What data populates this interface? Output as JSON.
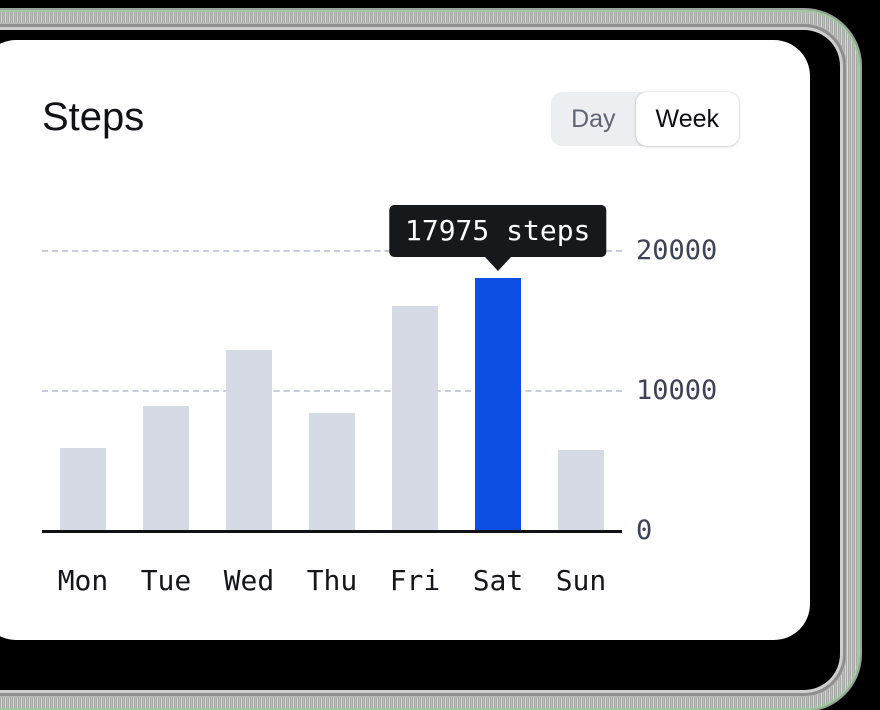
{
  "card": {
    "title": "Steps"
  },
  "range_toggle": {
    "options": [
      {
        "label": "Day",
        "active": false
      },
      {
        "label": "Week",
        "active": true
      }
    ]
  },
  "tooltip": {
    "text": "17975 steps",
    "anchor_category": "Sat",
    "background": "#17181c",
    "text_color": "#ffffff"
  },
  "colors": {
    "bar": "#d6dae4",
    "bar_highlight": "#0b4fe5",
    "gridline": "#c9cddb",
    "axis": "#111216",
    "toggle_track": "#eceef2",
    "toggle_active_bg": "#ffffff",
    "toggle_inactive_text": "#5f6474",
    "card_background": "#ffffff"
  },
  "chart_data": {
    "type": "bar",
    "title": "Steps",
    "xlabel": "",
    "ylabel": "",
    "categories": [
      "Mon",
      "Tue",
      "Wed",
      "Thu",
      "Fri",
      "Sat",
      "Sun"
    ],
    "values": [
      5850,
      8850,
      12850,
      8350,
      16000,
      17975,
      5700
    ],
    "highlight_index": 5,
    "ylim": [
      0,
      21500
    ],
    "yticks": [
      0,
      10000,
      20000
    ],
    "ytick_labels": [
      "0",
      "10000",
      "20000"
    ],
    "grid": true,
    "gridlines_at": [
      10000,
      20000
    ],
    "legend": null,
    "annotations": [
      {
        "category": "Sat",
        "value": 17975,
        "label": "17975 steps"
      }
    ]
  }
}
